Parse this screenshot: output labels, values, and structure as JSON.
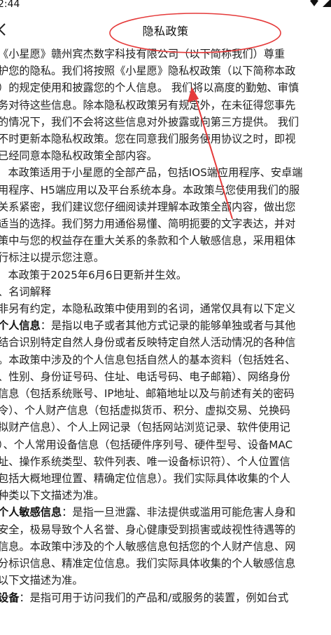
{
  "status_bar": {
    "time": "2:44"
  },
  "header": {
    "title": "隐私政策",
    "back_icon": "chevron-left-icon"
  },
  "annotation": {
    "color": "#e53a3a"
  },
  "policy": {
    "lines": [
      {
        "text": "《小星愿》赣州宾杰数字科技有限公司（以下简称我们）尊重"
      },
      {
        "text": "护您的隐私。我们将按照《小星愿》隐私权政策（以下简称本政"
      },
      {
        "text": "）的规定使用和披露您的个人信息。 我们将以高度的勤勉、审慎"
      },
      {
        "text": "务对待这些信息。除本隐私权政策另有规定外，在未征得您事先"
      },
      {
        "text": "的情况下，我们不会将这些信息对外披露或向第三方提供。 我们"
      },
      {
        "text": "不时更新本隐私权政策。您在同意我们服务使用协议之时，即视"
      },
      {
        "text": "已经同意本隐私权政策全部内容。"
      },
      {
        "text": "   本政策适用于小星愿的全部产品，包括IOS端应用程序、安卓端"
      },
      {
        "text": "用程序、H5端应用以及平台系统本身。本政策与您使用我们的服"
      },
      {
        "text": "关系紧密，我们建议您仔细阅读并理解本政策全部内容，做出您"
      },
      {
        "text": "适当的选择。我们努力用通俗易懂、简明扼要的文字表达，并对"
      },
      {
        "text": "策中与您的权益存在重大关系的条款和个人敏感信息，采用粗体"
      },
      {
        "text": "行标注以提示您注意。"
      },
      {
        "text": "   本政策于2025年6月6日更新并生效。"
      },
      {
        "text": "、名词解释"
      },
      {
        "text": "非另有约定，本隐私政策中使用到的名词，通常仅具有以下定义"
      },
      {
        "bold": "个人信息",
        "text": "：是指以电子或者其他方式记录的能够单独或者与其他"
      },
      {
        "text": "结合识别特定自然人身份或者反映特定自然人活动情况的各种信"
      },
      {
        "text": "。本政策中涉及的个人信息包括自然人的基本资料（包括姓名、"
      },
      {
        "text": "、性别、身份证号码、住址、电话号码、电子邮箱）、网络身份"
      },
      {
        "text": "信息（包括系统账号、IP地址、邮箱地址以及与前述有关的密码"
      },
      {
        "text": "令）、个人财产信息（包括虚拟货币、积分、虚拟交易、兑换码"
      },
      {
        "text": "拟财产信息）、个人上网记录（包括网站浏览记录、软件使用记"
      },
      {
        "text": "）、个人常用设备信息（包括硬件序列号、硬件型号、设备MAC"
      },
      {
        "text": "址、操作系统类型、软件列表、唯一设备标识符）、个人位置信"
      },
      {
        "text": "包括大概地理位置、精确定位信息）。我们实际具体收集的个人"
      },
      {
        "text": "种类以下文描述为准。"
      },
      {
        "bold": "个人敏感信息",
        "text": "：是指一旦泄露、非法提供或滥用可能危害人身和"
      },
      {
        "text": "安全，极易导致个人名誉、身心健康受到损害或歧视性待遇等的"
      },
      {
        "text": "信息。本政策中涉及的个人敏感信息包括您的个人财产信息、网"
      },
      {
        "text": "分标识信息、精准定位信息。我们实际具体收集的个人敏感信息"
      },
      {
        "text": "以下文描述为准。"
      },
      {
        "bold": "设备",
        "text": "：是指可用于访问我们的产品和/或服务的装置，例如台式"
      }
    ]
  }
}
